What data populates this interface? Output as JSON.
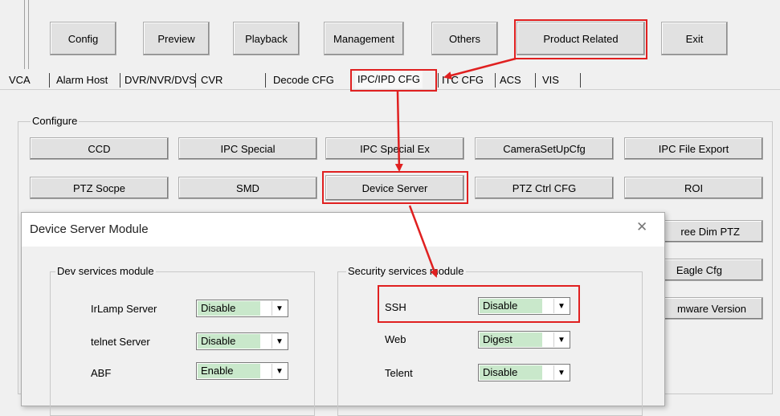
{
  "toolbar": {
    "config": "Config",
    "preview": "Preview",
    "playback": "Playback",
    "management": "Management",
    "others": "Others",
    "product_related": "Product Related",
    "exit": "Exit"
  },
  "tabs": [
    "VCA",
    "Alarm Host",
    "DVR/NVR/DVS",
    "CVR",
    "Decode CFG",
    "IPC/IPD CFG",
    "ITC CFG",
    "ACS",
    "VIS"
  ],
  "configure": {
    "title": "Configure",
    "row1": [
      "CCD",
      "IPC Special",
      "IPC Special Ex",
      "CameraSetUpCfg",
      "IPC File Export"
    ],
    "row2": [
      "PTZ Socpe",
      "SMD",
      "Device Server",
      "PTZ  Ctrl CFG",
      "ROI"
    ],
    "partial": [
      "ree Dim PTZ",
      "Eagle Cfg",
      "mware Version"
    ]
  },
  "dialog": {
    "title": "Device Server Module",
    "close": "✕",
    "dev_group": "Dev services module",
    "sec_group": "Security services module",
    "dev_rows": [
      {
        "label": "IrLamp Server",
        "value": "Disable"
      },
      {
        "label": "telnet Server",
        "value": "Disable"
      },
      {
        "label": "ABF",
        "value": "Enable"
      }
    ],
    "sec_rows": [
      {
        "label": "SSH",
        "value": "Disable"
      },
      {
        "label": "Web",
        "value": "Digest"
      },
      {
        "label": "Telent",
        "value": "Disable"
      }
    ]
  },
  "colors": {
    "annotation": "#e02020",
    "combo_fill": "#c9e8cb"
  },
  "icons": {
    "dropdown": "▼"
  }
}
